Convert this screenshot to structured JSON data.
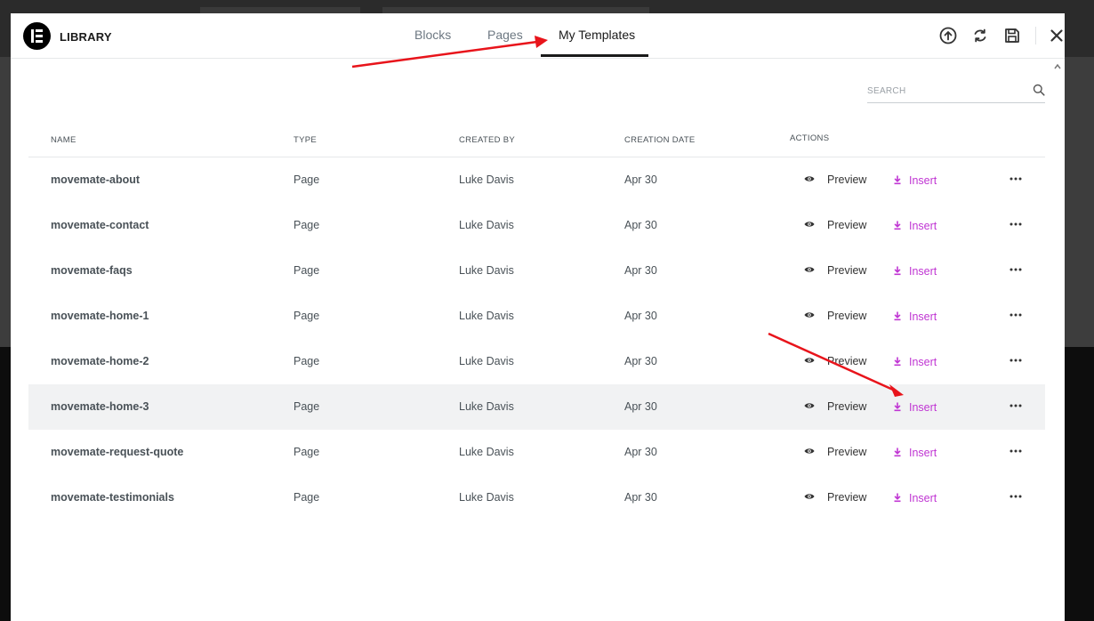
{
  "window": {
    "title": "LIBRARY"
  },
  "tabs": [
    {
      "label": "Blocks",
      "active": false
    },
    {
      "label": "Pages",
      "active": false
    },
    {
      "label": "My Templates",
      "active": true
    }
  ],
  "header_icons": [
    "upload-icon",
    "sync-icon",
    "save-icon",
    "close-icon"
  ],
  "search": {
    "placeholder": "SEARCH",
    "value": ""
  },
  "table": {
    "columns": [
      "NAME",
      "TYPE",
      "CREATED BY",
      "CREATION DATE",
      "ACTIONS"
    ],
    "rows": [
      {
        "name": "movemate-about",
        "type": "Page",
        "created_by": "Luke Davis",
        "date": "Apr 30",
        "preview": "Preview",
        "insert": "Insert"
      },
      {
        "name": "movemate-contact",
        "type": "Page",
        "created_by": "Luke Davis",
        "date": "Apr 30",
        "preview": "Preview",
        "insert": "Insert"
      },
      {
        "name": "movemate-faqs",
        "type": "Page",
        "created_by": "Luke Davis",
        "date": "Apr 30",
        "preview": "Preview",
        "insert": "Insert"
      },
      {
        "name": "movemate-home-1",
        "type": "Page",
        "created_by": "Luke Davis",
        "date": "Apr 30",
        "preview": "Preview",
        "insert": "Insert"
      },
      {
        "name": "movemate-home-2",
        "type": "Page",
        "created_by": "Luke Davis",
        "date": "Apr 30",
        "preview": "Preview",
        "insert": "Insert"
      },
      {
        "name": "movemate-home-3",
        "type": "Page",
        "created_by": "Luke Davis",
        "date": "Apr 30",
        "preview": "Preview",
        "insert": "Insert",
        "highlighted": true
      },
      {
        "name": "movemate-request-quote",
        "type": "Page",
        "created_by": "Luke Davis",
        "date": "Apr 30",
        "preview": "Preview",
        "insert": "Insert"
      },
      {
        "name": "movemate-testimonials",
        "type": "Page",
        "created_by": "Luke Davis",
        "date": "Apr 30",
        "preview": "Preview",
        "insert": "Insert"
      }
    ]
  },
  "colors": {
    "accent": "#c036d3",
    "text": "#495157",
    "annotation_arrow": "#e8141b",
    "row_highlight": "#f1f2f3"
  }
}
